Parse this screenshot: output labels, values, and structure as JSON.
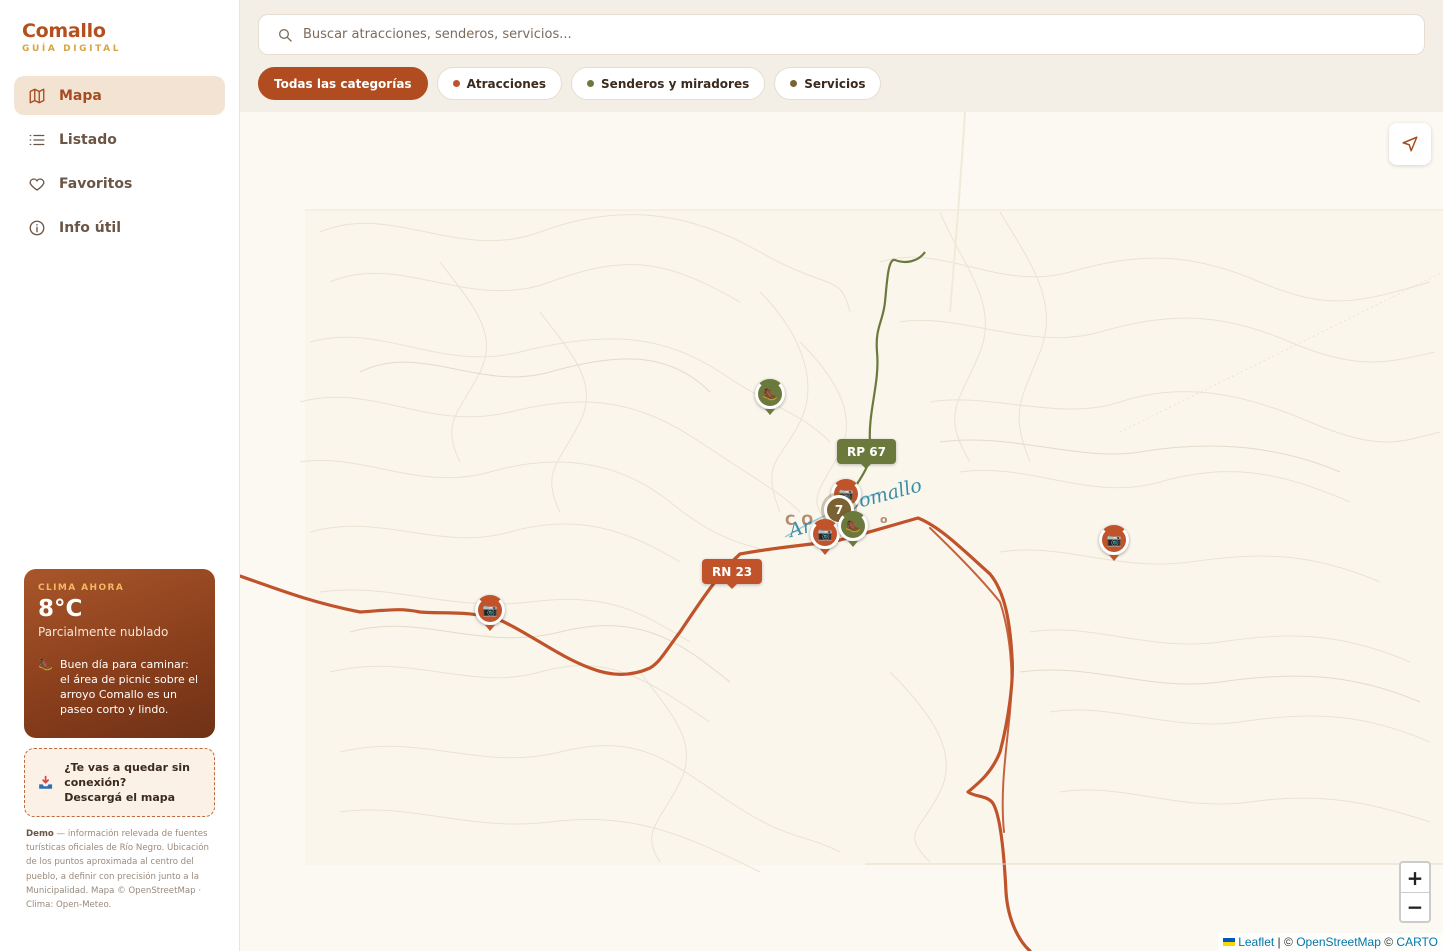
{
  "brand": {
    "name": "Comallo",
    "subtitle": "GUÍA DIGITAL"
  },
  "nav": {
    "items": [
      {
        "label": "Mapa",
        "icon": "map-icon",
        "active": true
      },
      {
        "label": "Listado",
        "icon": "list-icon",
        "active": false
      },
      {
        "label": "Favoritos",
        "icon": "heart-icon",
        "active": false
      },
      {
        "label": "Info útil",
        "icon": "info-icon",
        "active": false
      }
    ]
  },
  "weather": {
    "label": "CLIMA AHORA",
    "temperature": "8°C",
    "condition": "Parcialmente nublado",
    "tip_icon": "hiking-boot-icon",
    "tip": "Buen día para caminar: el área de picnic sobre el arroyo Comallo es un paseo corto y lindo."
  },
  "offline": {
    "icon": "download-inbox-icon",
    "line1": "¿Te vas a quedar sin conexión?",
    "line2": "Descargá el mapa"
  },
  "credits": {
    "lead": "Demo",
    "text": " — información relevada de fuentes turísticas oficiales de Río Negro. Ubicación de los puntos aproximada al centro del pueblo, a definir con precisión junto a la Municipalidad. Mapa © OpenStreetMap · Clima: Open-Meteo."
  },
  "search": {
    "placeholder": "Buscar atracciones, senderos, servicios..."
  },
  "filters": [
    {
      "label": "Todas las categorías",
      "active": true,
      "dot": null
    },
    {
      "label": "Atracciones",
      "active": false,
      "dot": "#c0532a"
    },
    {
      "label": "Senderos y miradores",
      "active": false,
      "dot": "#6b7a3c"
    },
    {
      "label": "Servicios",
      "active": false,
      "dot": "#7a6232"
    }
  ],
  "map": {
    "road_labels": {
      "rn23": "RN 23",
      "rp67": "RP 67"
    },
    "town_name": "Comallo",
    "town_name_big": "CO",
    "town_suffix": "o",
    "creek_prefix": "Ar",
    "cluster_count": "7",
    "markers": [
      {
        "category": "senderos",
        "icon": "hiking-boot-icon"
      },
      {
        "category": "atracciones",
        "icon": "camera-icon"
      },
      {
        "category": "atracciones",
        "icon": "camera-icon"
      },
      {
        "category": "atracciones",
        "icon": "camera-icon"
      },
      {
        "category": "senderos",
        "icon": "hiking-boot-icon"
      },
      {
        "category": "atracciones",
        "icon": "camera-icon"
      }
    ],
    "zoom_in": "+",
    "zoom_out": "−",
    "attribution": {
      "leaflet": "Leaflet",
      "sep1": " | © ",
      "osm": "OpenStreetMap",
      "sep2": " © ",
      "carto": "CARTO"
    },
    "colors": {
      "road": "#c0532a",
      "trail": "#6b7a3c",
      "background": "#fbf9f1"
    }
  }
}
